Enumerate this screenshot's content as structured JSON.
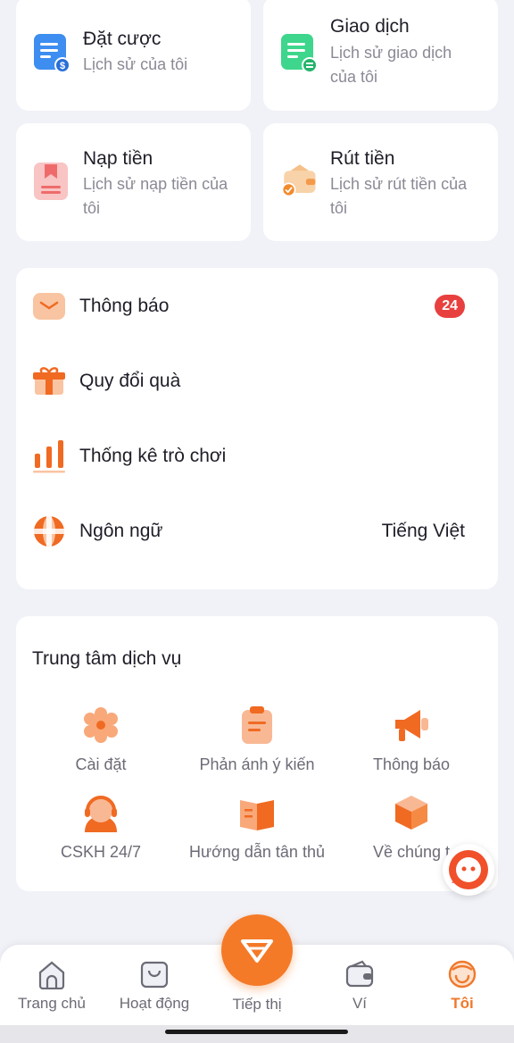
{
  "history_cards": [
    {
      "title": "Đặt cược",
      "subtitle": [
        "Lịch sử của tôi"
      ],
      "icon": "bet-document-icon",
      "color": "#3d8ef0"
    },
    {
      "title": "Giao dịch",
      "subtitle": [
        "Lịch sử giao dịch",
        "của tôi"
      ],
      "icon": "transaction-document-icon",
      "color": "#3ed68c"
    },
    {
      "title": "Nạp tiền",
      "subtitle": [
        "Lịch sử nạp tiền của",
        "tôi"
      ],
      "icon": "deposit-icon",
      "color": "#f7b2b2"
    },
    {
      "title": "Rút tiền",
      "subtitle": [
        "Lịch sử rút tiền của",
        "tôi"
      ],
      "icon": "withdraw-wallet-icon",
      "color": "#f6c89a"
    }
  ],
  "menu": {
    "notifications": {
      "label": "Thông báo",
      "badge": "24"
    },
    "gift_exchange": {
      "label": "Quy đổi quà"
    },
    "game_stats": {
      "label": "Thống kê trò chơi"
    },
    "language": {
      "label": "Ngôn ngữ",
      "value": "Tiếng Việt"
    }
  },
  "service_center": {
    "title": "Trung tâm dịch vụ",
    "items": [
      {
        "label": "Cài đặt",
        "icon": "settings-gear-icon"
      },
      {
        "label": "Phản ánh ý kiến",
        "icon": "feedback-clipboard-icon"
      },
      {
        "label": "Thông báo",
        "icon": "megaphone-icon"
      },
      {
        "label": "CSKH 24/7",
        "icon": "support-agent-icon"
      },
      {
        "label": "Hướng dẫn tân thủ",
        "icon": "guide-book-icon"
      },
      {
        "label": "Về chúng t",
        "icon": "about-box-icon"
      }
    ]
  },
  "tabbar": {
    "tabs": [
      {
        "label": "Trang chủ",
        "icon": "home-icon"
      },
      {
        "label": "Hoạt động",
        "icon": "activity-bag-icon"
      },
      {
        "label": "Tiếp thị",
        "icon": "diamond-icon"
      },
      {
        "label": "Ví",
        "icon": "wallet-icon"
      },
      {
        "label": "Tôi",
        "icon": "profile-face-icon",
        "active": true
      }
    ]
  },
  "colors": {
    "accent": "#f47a28",
    "badge": "#e8403f",
    "background": "#f1f2f7"
  }
}
